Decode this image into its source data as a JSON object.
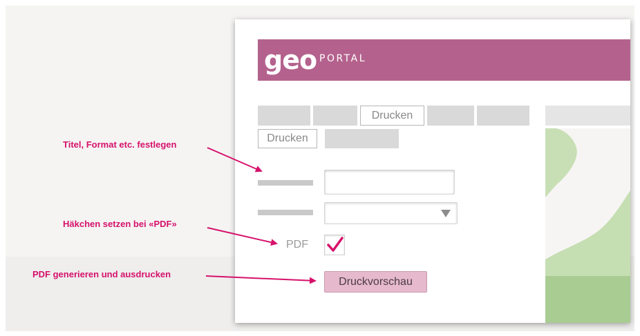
{
  "app": {
    "logo_text": "geo",
    "logo_suffix": "PORTAL",
    "brand_color": "#b4628d",
    "accent_color": "#d6116b"
  },
  "tabs": {
    "row1_active_label": "Drucken",
    "row2_active_label": "Drucken"
  },
  "form": {
    "pdf_label": "PDF",
    "pdf_checked": true,
    "preview_button_label": "Druckvorschau",
    "title_value": "",
    "format_value": ""
  },
  "annotations": {
    "title_format": "Titel, Format etc. festlegen",
    "pdf_check": "Häkchen setzen bei «PDF»",
    "generate": "PDF generieren und ausdrucken"
  }
}
